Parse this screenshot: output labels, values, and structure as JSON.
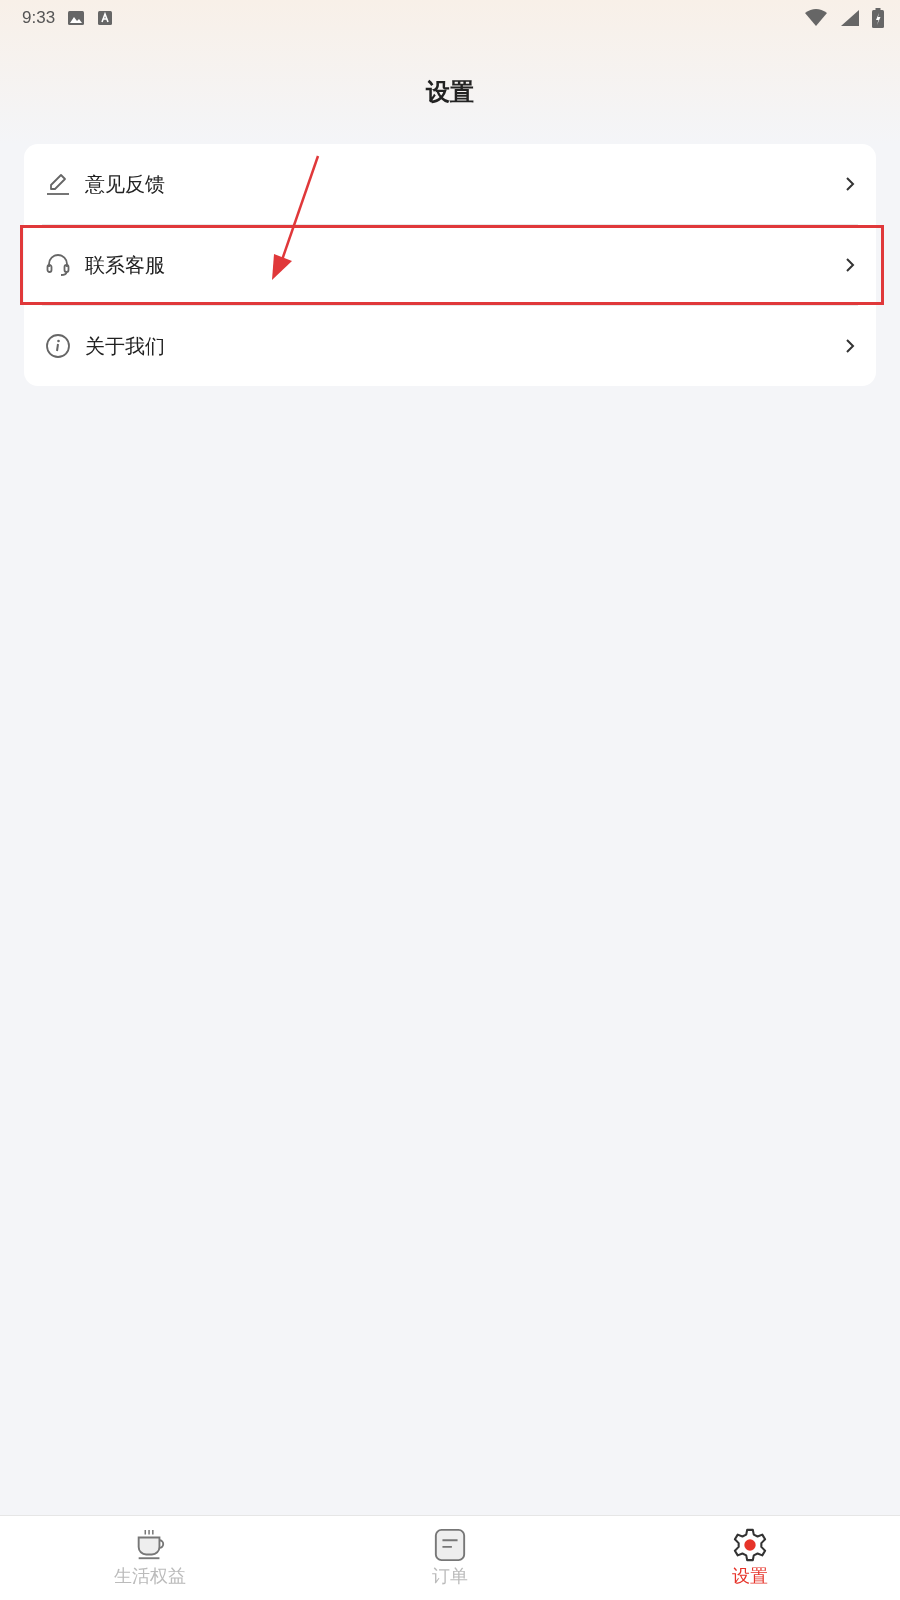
{
  "status_bar": {
    "time": "9:33"
  },
  "title": "设置",
  "menu": [
    {
      "kind": "feedback",
      "label": "意见反馈",
      "highlighted": false
    },
    {
      "kind": "support",
      "label": "联系客服",
      "highlighted": true
    },
    {
      "kind": "about",
      "label": "关于我们",
      "highlighted": false
    }
  ],
  "tabs": [
    {
      "kind": "benefits",
      "label": "生活权益",
      "selected": false
    },
    {
      "kind": "orders",
      "label": "订单",
      "selected": false
    },
    {
      "kind": "settings",
      "label": "设置",
      "selected": true
    }
  ]
}
